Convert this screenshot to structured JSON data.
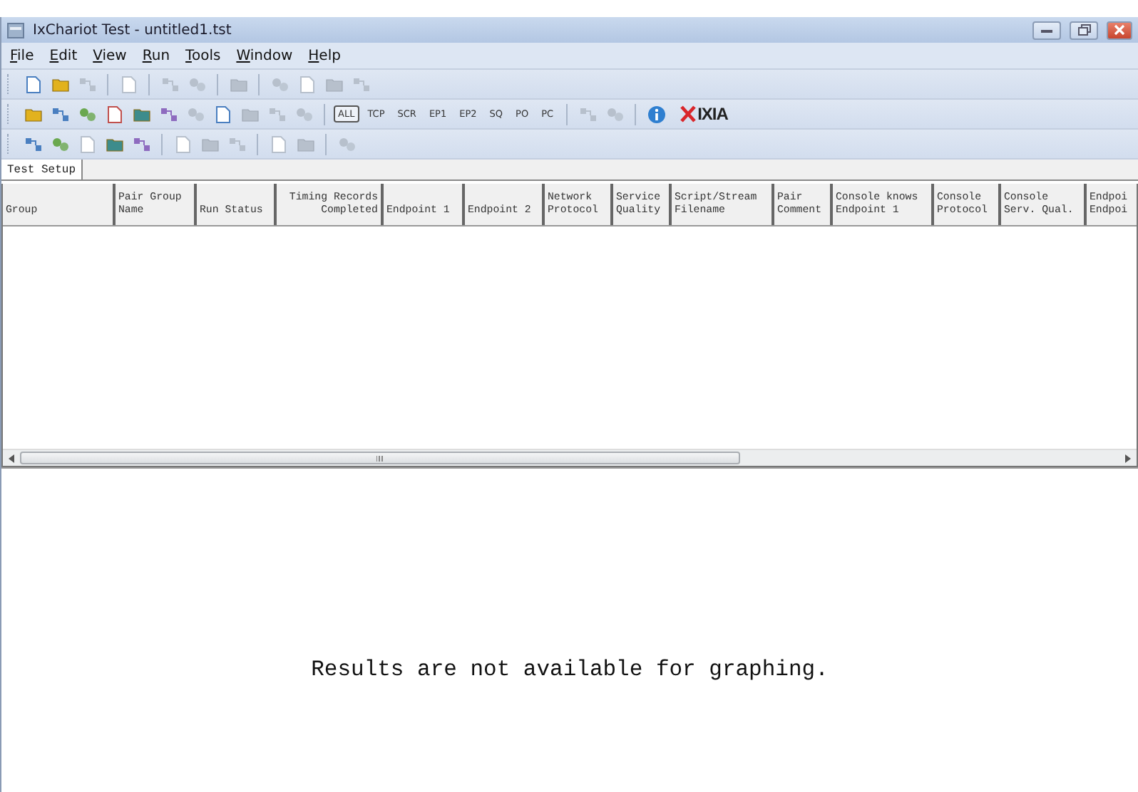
{
  "window": {
    "title": "IxChariot Test - untitled1.tst"
  },
  "menu": [
    {
      "label": "File"
    },
    {
      "label": "Edit"
    },
    {
      "label": "View"
    },
    {
      "label": "Run"
    },
    {
      "label": "Tools"
    },
    {
      "label": "Window"
    },
    {
      "label": "Help"
    }
  ],
  "toolbars": [
    {
      "items": [
        {
          "kind": "icon",
          "disabled": false
        },
        {
          "kind": "icon",
          "disabled": false
        },
        {
          "kind": "icon",
          "disabled": true
        },
        {
          "kind": "separator"
        },
        {
          "kind": "icon",
          "disabled": true
        },
        {
          "kind": "separator"
        },
        {
          "kind": "icon",
          "disabled": true
        },
        {
          "kind": "icon",
          "disabled": true
        },
        {
          "kind": "separator"
        },
        {
          "kind": "icon",
          "disabled": true
        },
        {
          "kind": "separator"
        },
        {
          "kind": "icon",
          "disabled": true
        },
        {
          "kind": "icon",
          "disabled": true
        },
        {
          "kind": "icon",
          "disabled": true
        },
        {
          "kind": "icon",
          "disabled": true
        }
      ]
    },
    {
      "items": [
        {
          "kind": "icon",
          "disabled": false
        },
        {
          "kind": "icon",
          "disabled": false
        },
        {
          "kind": "icon",
          "disabled": false
        },
        {
          "kind": "icon",
          "disabled": false
        },
        {
          "kind": "icon",
          "disabled": false
        },
        {
          "kind": "icon",
          "disabled": false
        },
        {
          "kind": "icon",
          "disabled": true
        },
        {
          "kind": "icon",
          "disabled": false
        },
        {
          "kind": "icon",
          "disabled": true
        },
        {
          "kind": "icon",
          "disabled": true
        },
        {
          "kind": "icon",
          "disabled": true
        },
        {
          "kind": "separator"
        },
        {
          "kind": "filter",
          "label": "ALL",
          "selected": true
        },
        {
          "kind": "filter",
          "label": "TCP",
          "selected": false
        },
        {
          "kind": "filter",
          "label": "SCR",
          "selected": false
        },
        {
          "kind": "filter",
          "label": "EP1",
          "selected": false
        },
        {
          "kind": "filter",
          "label": "EP2",
          "selected": false
        },
        {
          "kind": "filter",
          "label": "SQ",
          "selected": false
        },
        {
          "kind": "filter",
          "label": "PO",
          "selected": false
        },
        {
          "kind": "filter",
          "label": "PC",
          "selected": false
        },
        {
          "kind": "separator"
        },
        {
          "kind": "icon",
          "disabled": true
        },
        {
          "kind": "icon",
          "disabled": true
        },
        {
          "kind": "separator"
        },
        {
          "kind": "info"
        },
        {
          "kind": "logo",
          "label": "IXIA"
        }
      ]
    },
    {
      "items": [
        {
          "kind": "icon",
          "disabled": false
        },
        {
          "kind": "icon",
          "disabled": false
        },
        {
          "kind": "icon",
          "disabled": true
        },
        {
          "kind": "icon",
          "disabled": false
        },
        {
          "kind": "icon",
          "disabled": false
        },
        {
          "kind": "separator"
        },
        {
          "kind": "icon",
          "disabled": true
        },
        {
          "kind": "icon",
          "disabled": true
        },
        {
          "kind": "icon",
          "disabled": true
        },
        {
          "kind": "separator"
        },
        {
          "kind": "icon",
          "disabled": true
        },
        {
          "kind": "icon",
          "disabled": true
        },
        {
          "kind": "separator"
        },
        {
          "kind": "icon",
          "disabled": true
        }
      ]
    }
  ],
  "tabs": [
    {
      "label": "Test Setup",
      "selected": true
    }
  ],
  "table": {
    "columns": [
      {
        "lines": [
          "Group"
        ],
        "right_aligned": false
      },
      {
        "lines": [
          "Pair Group",
          "Name"
        ],
        "right_aligned": false
      },
      {
        "lines": [
          "Run Status"
        ],
        "right_aligned": false
      },
      {
        "lines": [
          "Timing Records",
          "Completed"
        ],
        "right_aligned": true
      },
      {
        "lines": [
          "Endpoint 1"
        ],
        "right_aligned": false
      },
      {
        "lines": [
          "Endpoint 2"
        ],
        "right_aligned": false
      },
      {
        "lines": [
          "Network",
          "Protocol"
        ],
        "right_aligned": false
      },
      {
        "lines": [
          "Service",
          "Quality"
        ],
        "right_aligned": false
      },
      {
        "lines": [
          "Script/Stream",
          "Filename"
        ],
        "right_aligned": false
      },
      {
        "lines": [
          "Pair",
          "Comment"
        ],
        "right_aligned": false
      },
      {
        "lines": [
          "Console knows",
          "Endpoint 1"
        ],
        "right_aligned": false
      },
      {
        "lines": [
          "Console",
          "Protocol"
        ],
        "right_aligned": false
      },
      {
        "lines": [
          "Console",
          "Serv. Qual."
        ],
        "right_aligned": false
      },
      {
        "lines": [
          "Endpoi",
          "Endpoi"
        ],
        "right_aligned": false
      }
    ]
  },
  "graph": {
    "message": "Results are not available for graphing."
  }
}
